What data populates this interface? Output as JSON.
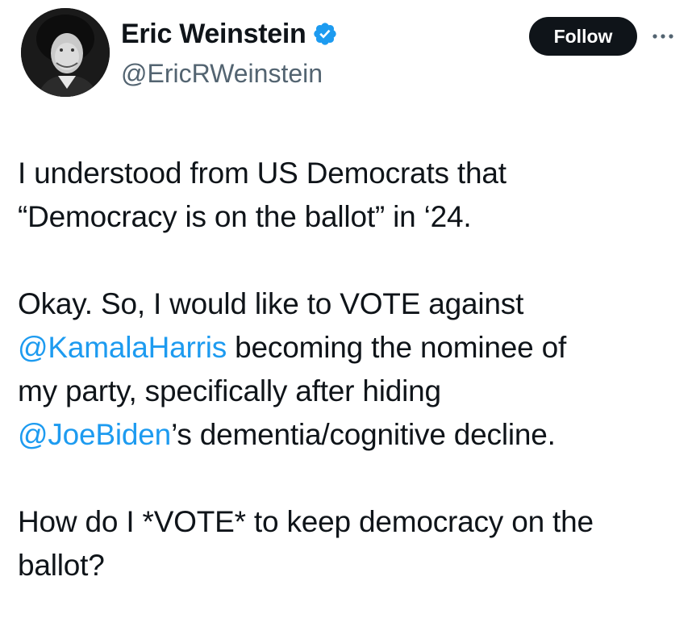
{
  "author": {
    "display_name": "Eric Weinstein",
    "handle": "@EricRWeinstein",
    "verified_icon": "verified-badge-icon",
    "verified_color": "#1d9bf0",
    "avatar_icon": "profile-photo"
  },
  "actions": {
    "follow_label": "Follow",
    "more_icon": "ellipsis-icon"
  },
  "tweet": {
    "p1": {
      "line1": "I understood from US Democrats that",
      "line2": "“Democracy is on the ballot” in ‘24."
    },
    "p2": {
      "line1": "Okay. So, I would like to VOTE against",
      "mention1": "@KamalaHarris",
      "line2_rest": " becoming the nominee of",
      "line3": "my party, specifically after hiding",
      "mention2": "@JoeBiden",
      "line4_rest": "’s dementia/cognitive decline."
    },
    "p3": {
      "line1": "How do I *VOTE* to keep democracy on the",
      "line2": "ballot?"
    }
  },
  "colors": {
    "text": "#0f1419",
    "secondary": "#536471",
    "link": "#1d9bf0",
    "button_bg": "#0f1419",
    "button_text": "#ffffff"
  }
}
